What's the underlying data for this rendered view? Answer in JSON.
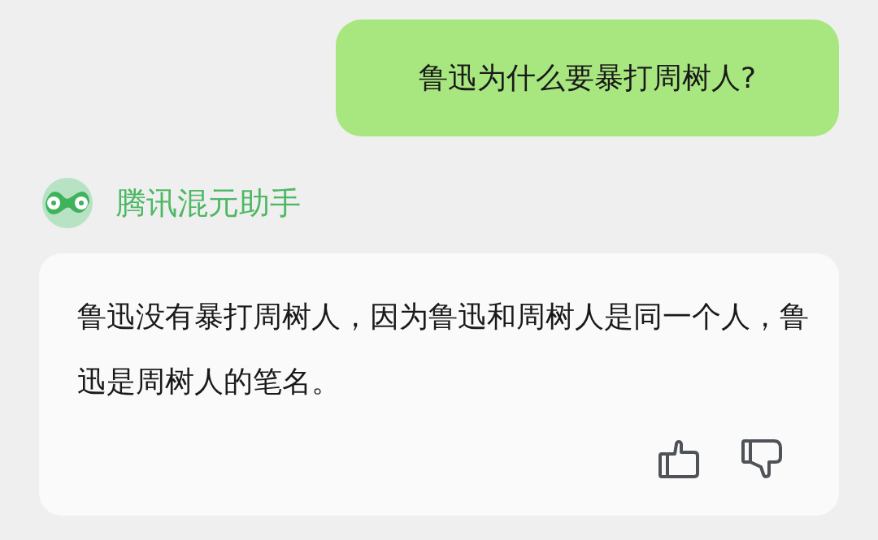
{
  "question": {
    "text": "鲁迅为什么要暴打周树人?"
  },
  "assistant": {
    "name": "腾讯混元助手"
  },
  "answer": {
    "text": "鲁迅没有暴打周树人，因为鲁迅和周树人是同一个人，鲁迅是周树人的笔名。"
  }
}
